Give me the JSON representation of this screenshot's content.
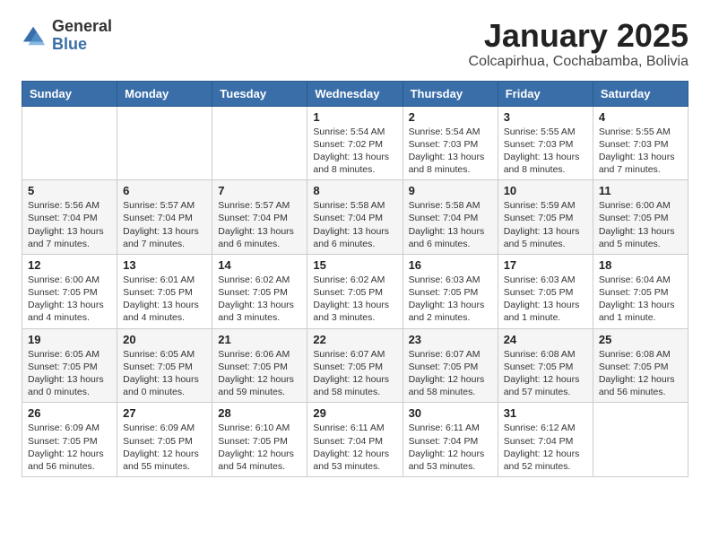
{
  "logo": {
    "general": "General",
    "blue": "Blue"
  },
  "header": {
    "month": "January 2025",
    "location": "Colcapirhua, Cochabamba, Bolivia"
  },
  "days_of_week": [
    "Sunday",
    "Monday",
    "Tuesday",
    "Wednesday",
    "Thursday",
    "Friday",
    "Saturday"
  ],
  "weeks": [
    [
      {
        "day": "",
        "info": ""
      },
      {
        "day": "",
        "info": ""
      },
      {
        "day": "",
        "info": ""
      },
      {
        "day": "1",
        "info": "Sunrise: 5:54 AM\nSunset: 7:02 PM\nDaylight: 13 hours\nand 8 minutes."
      },
      {
        "day": "2",
        "info": "Sunrise: 5:54 AM\nSunset: 7:03 PM\nDaylight: 13 hours\nand 8 minutes."
      },
      {
        "day": "3",
        "info": "Sunrise: 5:55 AM\nSunset: 7:03 PM\nDaylight: 13 hours\nand 8 minutes."
      },
      {
        "day": "4",
        "info": "Sunrise: 5:55 AM\nSunset: 7:03 PM\nDaylight: 13 hours\nand 7 minutes."
      }
    ],
    [
      {
        "day": "5",
        "info": "Sunrise: 5:56 AM\nSunset: 7:04 PM\nDaylight: 13 hours\nand 7 minutes."
      },
      {
        "day": "6",
        "info": "Sunrise: 5:57 AM\nSunset: 7:04 PM\nDaylight: 13 hours\nand 7 minutes."
      },
      {
        "day": "7",
        "info": "Sunrise: 5:57 AM\nSunset: 7:04 PM\nDaylight: 13 hours\nand 6 minutes."
      },
      {
        "day": "8",
        "info": "Sunrise: 5:58 AM\nSunset: 7:04 PM\nDaylight: 13 hours\nand 6 minutes."
      },
      {
        "day": "9",
        "info": "Sunrise: 5:58 AM\nSunset: 7:04 PM\nDaylight: 13 hours\nand 6 minutes."
      },
      {
        "day": "10",
        "info": "Sunrise: 5:59 AM\nSunset: 7:05 PM\nDaylight: 13 hours\nand 5 minutes."
      },
      {
        "day": "11",
        "info": "Sunrise: 6:00 AM\nSunset: 7:05 PM\nDaylight: 13 hours\nand 5 minutes."
      }
    ],
    [
      {
        "day": "12",
        "info": "Sunrise: 6:00 AM\nSunset: 7:05 PM\nDaylight: 13 hours\nand 4 minutes."
      },
      {
        "day": "13",
        "info": "Sunrise: 6:01 AM\nSunset: 7:05 PM\nDaylight: 13 hours\nand 4 minutes."
      },
      {
        "day": "14",
        "info": "Sunrise: 6:02 AM\nSunset: 7:05 PM\nDaylight: 13 hours\nand 3 minutes."
      },
      {
        "day": "15",
        "info": "Sunrise: 6:02 AM\nSunset: 7:05 PM\nDaylight: 13 hours\nand 3 minutes."
      },
      {
        "day": "16",
        "info": "Sunrise: 6:03 AM\nSunset: 7:05 PM\nDaylight: 13 hours\nand 2 minutes."
      },
      {
        "day": "17",
        "info": "Sunrise: 6:03 AM\nSunset: 7:05 PM\nDaylight: 13 hours\nand 1 minute."
      },
      {
        "day": "18",
        "info": "Sunrise: 6:04 AM\nSunset: 7:05 PM\nDaylight: 13 hours\nand 1 minute."
      }
    ],
    [
      {
        "day": "19",
        "info": "Sunrise: 6:05 AM\nSunset: 7:05 PM\nDaylight: 13 hours\nand 0 minutes."
      },
      {
        "day": "20",
        "info": "Sunrise: 6:05 AM\nSunset: 7:05 PM\nDaylight: 13 hours\nand 0 minutes."
      },
      {
        "day": "21",
        "info": "Sunrise: 6:06 AM\nSunset: 7:05 PM\nDaylight: 12 hours\nand 59 minutes."
      },
      {
        "day": "22",
        "info": "Sunrise: 6:07 AM\nSunset: 7:05 PM\nDaylight: 12 hours\nand 58 minutes."
      },
      {
        "day": "23",
        "info": "Sunrise: 6:07 AM\nSunset: 7:05 PM\nDaylight: 12 hours\nand 58 minutes."
      },
      {
        "day": "24",
        "info": "Sunrise: 6:08 AM\nSunset: 7:05 PM\nDaylight: 12 hours\nand 57 minutes."
      },
      {
        "day": "25",
        "info": "Sunrise: 6:08 AM\nSunset: 7:05 PM\nDaylight: 12 hours\nand 56 minutes."
      }
    ],
    [
      {
        "day": "26",
        "info": "Sunrise: 6:09 AM\nSunset: 7:05 PM\nDaylight: 12 hours\nand 56 minutes."
      },
      {
        "day": "27",
        "info": "Sunrise: 6:09 AM\nSunset: 7:05 PM\nDaylight: 12 hours\nand 55 minutes."
      },
      {
        "day": "28",
        "info": "Sunrise: 6:10 AM\nSunset: 7:05 PM\nDaylight: 12 hours\nand 54 minutes."
      },
      {
        "day": "29",
        "info": "Sunrise: 6:11 AM\nSunset: 7:04 PM\nDaylight: 12 hours\nand 53 minutes."
      },
      {
        "day": "30",
        "info": "Sunrise: 6:11 AM\nSunset: 7:04 PM\nDaylight: 12 hours\nand 53 minutes."
      },
      {
        "day": "31",
        "info": "Sunrise: 6:12 AM\nSunset: 7:04 PM\nDaylight: 12 hours\nand 52 minutes."
      },
      {
        "day": "",
        "info": ""
      }
    ]
  ]
}
